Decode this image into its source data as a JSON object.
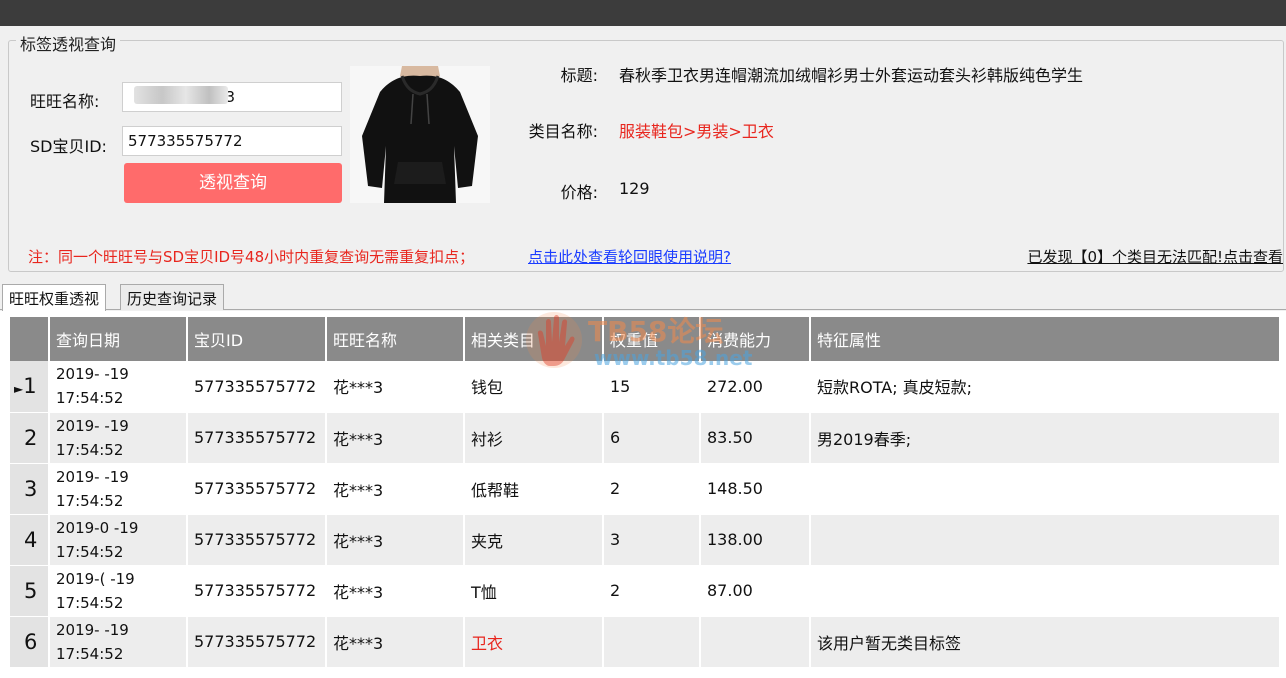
{
  "panel": {
    "title": "标签透视查询",
    "wangwang_label": "旺旺名称:",
    "wangwang_value": "3",
    "sd_id_label": "SD宝贝ID:",
    "sd_id_value": "577335575772",
    "query_button": "透视查询"
  },
  "product": {
    "image_icon": "black-hoodie-image",
    "title_label": "标题:",
    "title_value": "春秋季卫衣男连帽潮流加绒帽衫男士外套运动套头衫韩版纯色学生",
    "category_label": "类目名称:",
    "category_value": "服装鞋包>男装>卫衣",
    "price_label": "价格:",
    "price_value": "129"
  },
  "notes": {
    "warning": "注：同一个旺旺号与SD宝贝ID号48小时内重复查询无需重复扣点；",
    "help_link": "点击此处查看轮回眼使用说明?",
    "found_link": "已发现【0】个类目无法匹配!点击查看"
  },
  "tabs": [
    {
      "label": "旺旺权重透视"
    },
    {
      "label": "历史查询记录"
    }
  ],
  "table": {
    "columns": [
      "查询日期",
      "宝贝ID",
      "旺旺名称",
      "相关类目",
      "权重值",
      "消费能力",
      "特征属性"
    ],
    "rows": [
      {
        "idx": "1",
        "date": "2019-  -19",
        "time": "17:54:52",
        "item_id": "577335575772",
        "wangwang": "花***3",
        "category": "钱包",
        "weight": "15",
        "spend": "272.00",
        "traits": "短款ROTA;  真皮短款;"
      },
      {
        "idx": "2",
        "date": "2019-  -19",
        "time": "17:54:52",
        "item_id": "577335575772",
        "wangwang": "花***3",
        "category": "衬衫",
        "weight": "6",
        "spend": "83.50",
        "traits": "男2019春季;"
      },
      {
        "idx": "3",
        "date": "2019-  -19",
        "time": "17:54:52",
        "item_id": "577335575772",
        "wangwang": "花***3",
        "category": "低帮鞋",
        "weight": "2",
        "spend": "148.50",
        "traits": ""
      },
      {
        "idx": "4",
        "date": "2019-0  -19",
        "time": "17:54:52",
        "item_id": "577335575772",
        "wangwang": "花***3",
        "category": "夹克",
        "weight": "3",
        "spend": "138.00",
        "traits": ""
      },
      {
        "idx": "5",
        "date": "2019-(  -19",
        "time": "17:54:52",
        "item_id": "577335575772",
        "wangwang": "花***3",
        "category": "T恤",
        "weight": "2",
        "spend": "87.00",
        "traits": ""
      },
      {
        "idx": "6",
        "date": "2019-  -19",
        "time": "17:54:52",
        "item_id": "577335575772",
        "wangwang": "花***3",
        "category": "卫衣",
        "weight": "",
        "spend": "",
        "traits": "该用户暂无类目标签"
      }
    ]
  },
  "watermark": {
    "line1": "TB58论坛",
    "line2": "www.tb58.net"
  },
  "colors": {
    "accent_button": "#ff6b6b",
    "warning_red": "#e8261e",
    "link_blue": "#1a3cff",
    "header_gray": "#8a8a8a"
  }
}
